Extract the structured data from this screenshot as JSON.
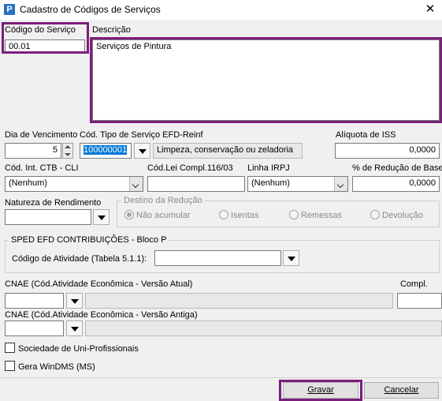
{
  "window": {
    "title": "Cadastro de Códigos de Serviços",
    "app_icon": "P",
    "close_glyph": "✕"
  },
  "codigo": {
    "label": "Código do Serviço",
    "value": "00.01"
  },
  "descricao": {
    "label": "Descrição",
    "value": "Serviços de Pintura"
  },
  "vencimento": {
    "label": "Dia de Vencimento",
    "value": "5"
  },
  "tipo_servico": {
    "label": "Cód. Tipo de Serviço EFD-Reinf",
    "value": "100000001",
    "description": "Limpeza, conservação ou zeladoria"
  },
  "aliquota": {
    "label": "Alíquota de ISS",
    "value": "0,0000"
  },
  "ctb": {
    "label": "Cód. Int. CTB - CLI",
    "value": "(Nenhum)"
  },
  "lei_compl": {
    "label": "Cód.Lei Compl.116/03",
    "value": ""
  },
  "irpj": {
    "label": "Linha IRPJ",
    "value": "(Nenhum)"
  },
  "reducao": {
    "label": "% de Redução de Base",
    "value": "0,0000"
  },
  "natureza": {
    "label": "Natureza de Rendimento",
    "value": ""
  },
  "destino": {
    "title": "Destino da Redução",
    "options": [
      "Não acumular",
      "Isentas",
      "Remessas",
      "Devolução"
    ],
    "selected": "Não acumular"
  },
  "sped": {
    "title": "SPED EFD CONTRIBUIÇÕES - Bloco P",
    "atividade_label": "Código de Atividade (Tabela 5.1.1):",
    "atividade_value": ""
  },
  "cnae_atual": {
    "label": "CNAE (Cód.Atividade Econômica - Versão Atual)"
  },
  "compl": {
    "label": "Compl."
  },
  "cnae_antiga": {
    "label": "CNAE (Cód.Atividade Econômica - Versão Antiga)"
  },
  "checks": {
    "uni_profissionais": "Sociedade de Uni-Profissionais",
    "windms": "Gera WinDMS (MS)"
  },
  "buttons": {
    "gravar": "Gravar",
    "cancelar": "Cancelar"
  },
  "colors": {
    "highlight": "#7b1f7a",
    "selection": "#0078d7"
  }
}
